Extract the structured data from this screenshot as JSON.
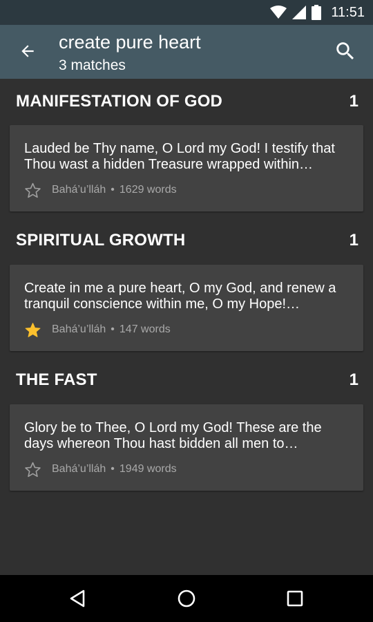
{
  "status_bar": {
    "time": "11:51"
  },
  "toolbar": {
    "title": "create pure heart",
    "subtitle": "3 matches"
  },
  "sections": [
    {
      "title": "MANIFESTATION OF GOD",
      "count": "1",
      "card": {
        "text": "Lauded be Thy name, O Lord my God! I testify that Thou wast a hidden Treasure wrapped within…",
        "author": "Bahá’u’lláh",
        "separator": "•",
        "words": "1629 words",
        "starred": false
      }
    },
    {
      "title": "SPIRITUAL GROWTH",
      "count": "1",
      "card": {
        "text": "Create in me a pure heart, O my God, and renew a tranquil conscience within me, O my Hope!…",
        "author": "Bahá’u’lláh",
        "separator": "•",
        "words": "147 words",
        "starred": true
      }
    },
    {
      "title": "THE FAST",
      "count": "1",
      "card": {
        "text": "Glory be to Thee, O Lord my God! These are the days whereon Thou hast bidden all men to…",
        "author": "Bahá’u’lláh",
        "separator": "•",
        "words": "1949 words",
        "starred": false
      }
    }
  ],
  "icons": {
    "back": "arrow-back-icon",
    "search": "search-icon",
    "star_filled": "star-icon",
    "star_empty": "star-outline-icon",
    "nav_back": "nav-back-icon",
    "nav_home": "nav-home-icon",
    "nav_recents": "nav-recents-icon"
  },
  "colors": {
    "toolbar": "#455a64",
    "status_bar": "#2c3940",
    "background": "#303030",
    "card": "#424242",
    "star_active": "#fbc02d",
    "meta_text": "#a9a9a9"
  }
}
